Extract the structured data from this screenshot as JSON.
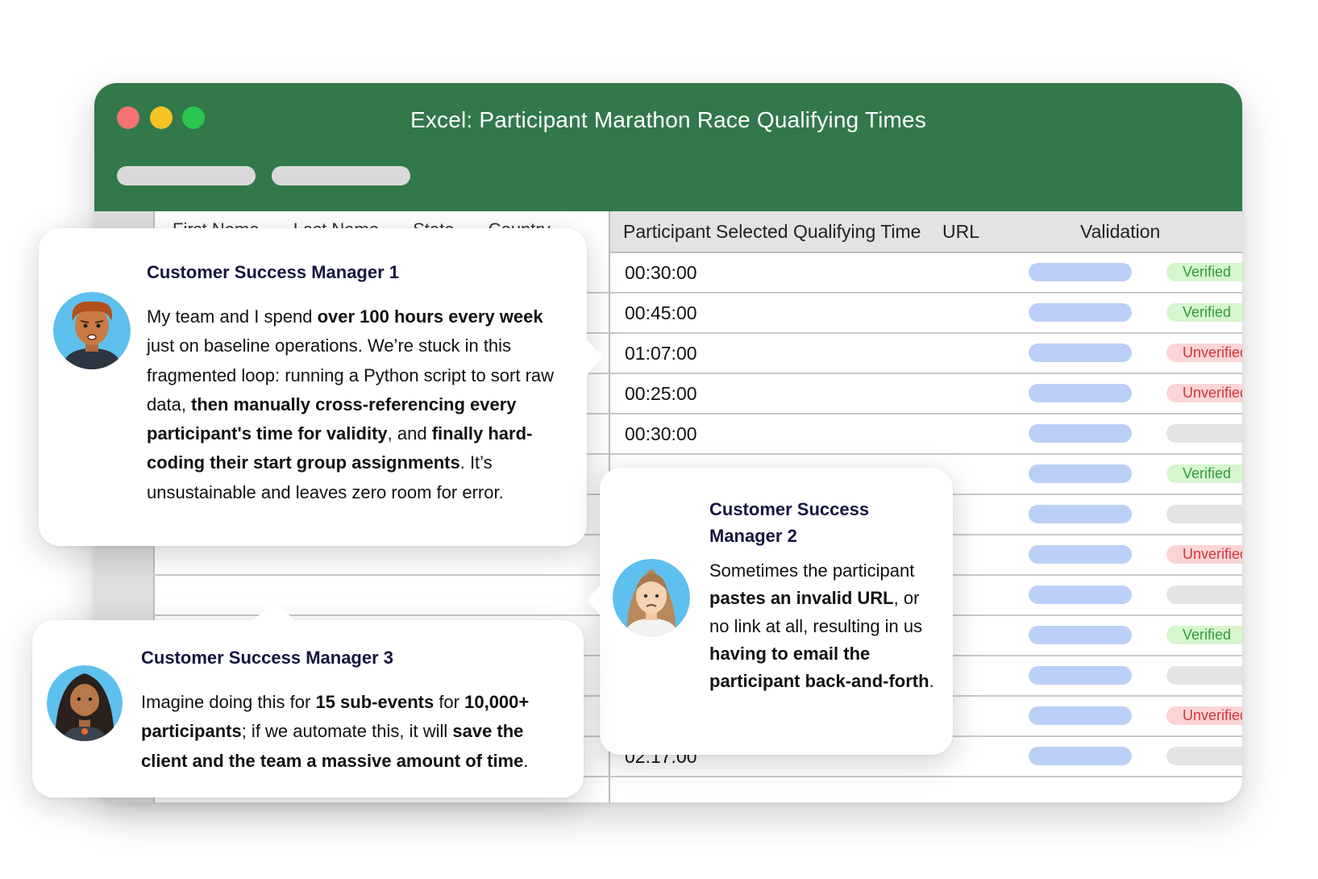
{
  "window": {
    "title": "Excel: Participant Marathon Race Qualifying Times",
    "accent_color": "#32784b"
  },
  "sheet": {
    "hidden_headers": [
      "First Name",
      "Last Name",
      "State",
      "Country"
    ],
    "columns": {
      "time": "Participant Selected Qualifying Time",
      "url": "URL",
      "validation": "Validation"
    },
    "rows": [
      {
        "time": "00:30:00",
        "validation": "Verified"
      },
      {
        "time": "00:45:00",
        "validation": "Verified"
      },
      {
        "time": "01:07:00",
        "validation": "Unverified"
      },
      {
        "time": "00:25:00",
        "validation": "Unverified"
      },
      {
        "time": "00:30:00",
        "validation": ""
      },
      {
        "time": "",
        "validation": "Verified"
      },
      {
        "time": "",
        "validation": ""
      },
      {
        "time": "",
        "validation": "Unverified"
      },
      {
        "time": "",
        "validation": ""
      },
      {
        "time": "",
        "validation": "Verified"
      },
      {
        "time": "",
        "validation": ""
      },
      {
        "time": "",
        "validation": "Unverified"
      },
      {
        "time": "02:17:00",
        "validation": ""
      }
    ]
  },
  "cards": {
    "csm1": {
      "name": "Customer Success Manager 1",
      "segments": [
        {
          "text": "My team and I spend ",
          "bold": false
        },
        {
          "text": "over 100 hours every week",
          "bold": true
        },
        {
          "text": " just on baseline operations. We’re stuck in this fragmented loop: running a Python script to sort raw data, ",
          "bold": false
        },
        {
          "text": "then manually cross-referencing every participant's time for validity",
          "bold": true
        },
        {
          "text": ", and ",
          "bold": false
        },
        {
          "text": "finally hard-coding their start group assignments",
          "bold": true
        },
        {
          "text": ". It’s unsustainable and leaves zero room for error.",
          "bold": false
        }
      ]
    },
    "csm2": {
      "name": "Customer Success Manager 2",
      "segments": [
        {
          "text": "Sometimes the participant ",
          "bold": false
        },
        {
          "text": "pastes an invalid URL",
          "bold": true
        },
        {
          "text": ", or no link at all, resulting in us ",
          "bold": false
        },
        {
          "text": "having to email the participant back-and-forth",
          "bold": true
        },
        {
          "text": ".",
          "bold": false
        }
      ]
    },
    "csm3": {
      "name": "Customer Success Manager 3",
      "segments": [
        {
          "text": "Imagine doing this for ",
          "bold": false
        },
        {
          "text": "15 sub-events",
          "bold": true
        },
        {
          "text": " for ",
          "bold": false
        },
        {
          "text": "10,000+ participants",
          "bold": true
        },
        {
          "text": "; if we automate this, it will ",
          "bold": false
        },
        {
          "text": "save the client and the team a massive amount of time",
          "bold": true
        },
        {
          "text": ".",
          "bold": false
        }
      ]
    }
  }
}
